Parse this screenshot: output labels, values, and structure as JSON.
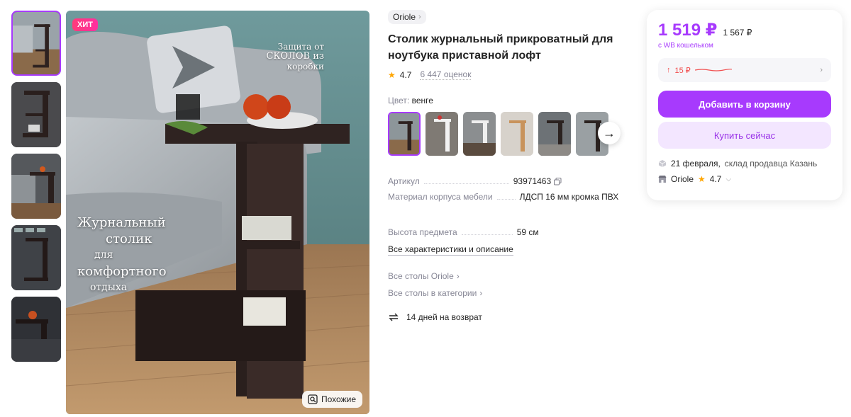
{
  "badge": "ХИТ",
  "photo": {
    "protect_text_1": "Защита от",
    "protect_text_2": "СКОЛОВ из",
    "protect_text_3": "коробки",
    "title_1": "Журнальный",
    "title_2": "столик",
    "title_3": "для",
    "title_4": "комфортного",
    "title_5": "отдыха",
    "similar_label": "Похожие"
  },
  "product": {
    "brand": "Oriole",
    "title": "Столик журнальный прикроватный для ноутбука приставной лофт",
    "rating": "4.7",
    "reviews": "6 447 оценок",
    "color_label": "Цвет:",
    "color_value": "венге"
  },
  "specs": [
    {
      "key": "Артикул",
      "value": "93971463"
    },
    {
      "key": "Материал корпуса мебели",
      "value": "ЛДСП 16 мм кромка ПВХ"
    },
    {
      "key": "Высота предмета",
      "value": "59 см"
    }
  ],
  "links": {
    "all_chars": "Все характеристики и описание",
    "all_brand": "Все столы Oriole",
    "all_category": "Все столы в категории",
    "return": "14 дней на возврат"
  },
  "card": {
    "price": "1 519 ₽",
    "old_price": "1 567 ₽",
    "wallet": "с WB кошельком",
    "history": "15 ₽",
    "add_to_cart": "Добавить в корзину",
    "buy_now": "Купить сейчас",
    "delivery_date": "21 февраля,",
    "delivery_rest": "склад продавца Казань",
    "seller_name": "Oriole",
    "seller_rating": "4.7"
  },
  "colors": {
    "accent": "#a73afd",
    "accent_light": "#f3e6ff",
    "badge": "#ff2f8a",
    "price_up": "#f14f4f"
  }
}
